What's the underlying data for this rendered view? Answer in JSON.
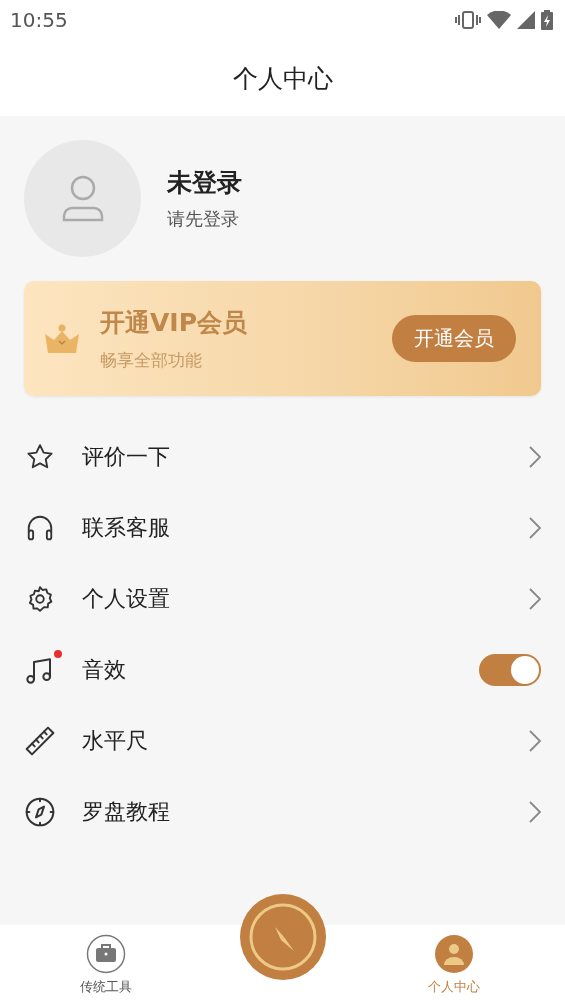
{
  "status_bar": {
    "time": "10:55"
  },
  "header": {
    "title": "个人中心"
  },
  "profile": {
    "name": "未登录",
    "hint": "请先登录"
  },
  "vip_card": {
    "title": "开通VIP会员",
    "subtitle": "畅享全部功能",
    "button": "开通会员"
  },
  "menu": [
    {
      "kind": "link",
      "label": "评价一下",
      "badge": false
    },
    {
      "kind": "link",
      "label": "联系客服",
      "badge": false
    },
    {
      "kind": "link",
      "label": "个人设置",
      "badge": false
    },
    {
      "kind": "toggle",
      "label": "音效",
      "badge": true,
      "on": true
    },
    {
      "kind": "link",
      "label": "水平尺",
      "badge": false
    },
    {
      "kind": "link",
      "label": "罗盘教程",
      "badge": false
    }
  ],
  "bottom_nav": [
    {
      "label": "传统工具",
      "selected": false
    },
    {
      "label": "个人中心",
      "selected": true
    }
  ]
}
